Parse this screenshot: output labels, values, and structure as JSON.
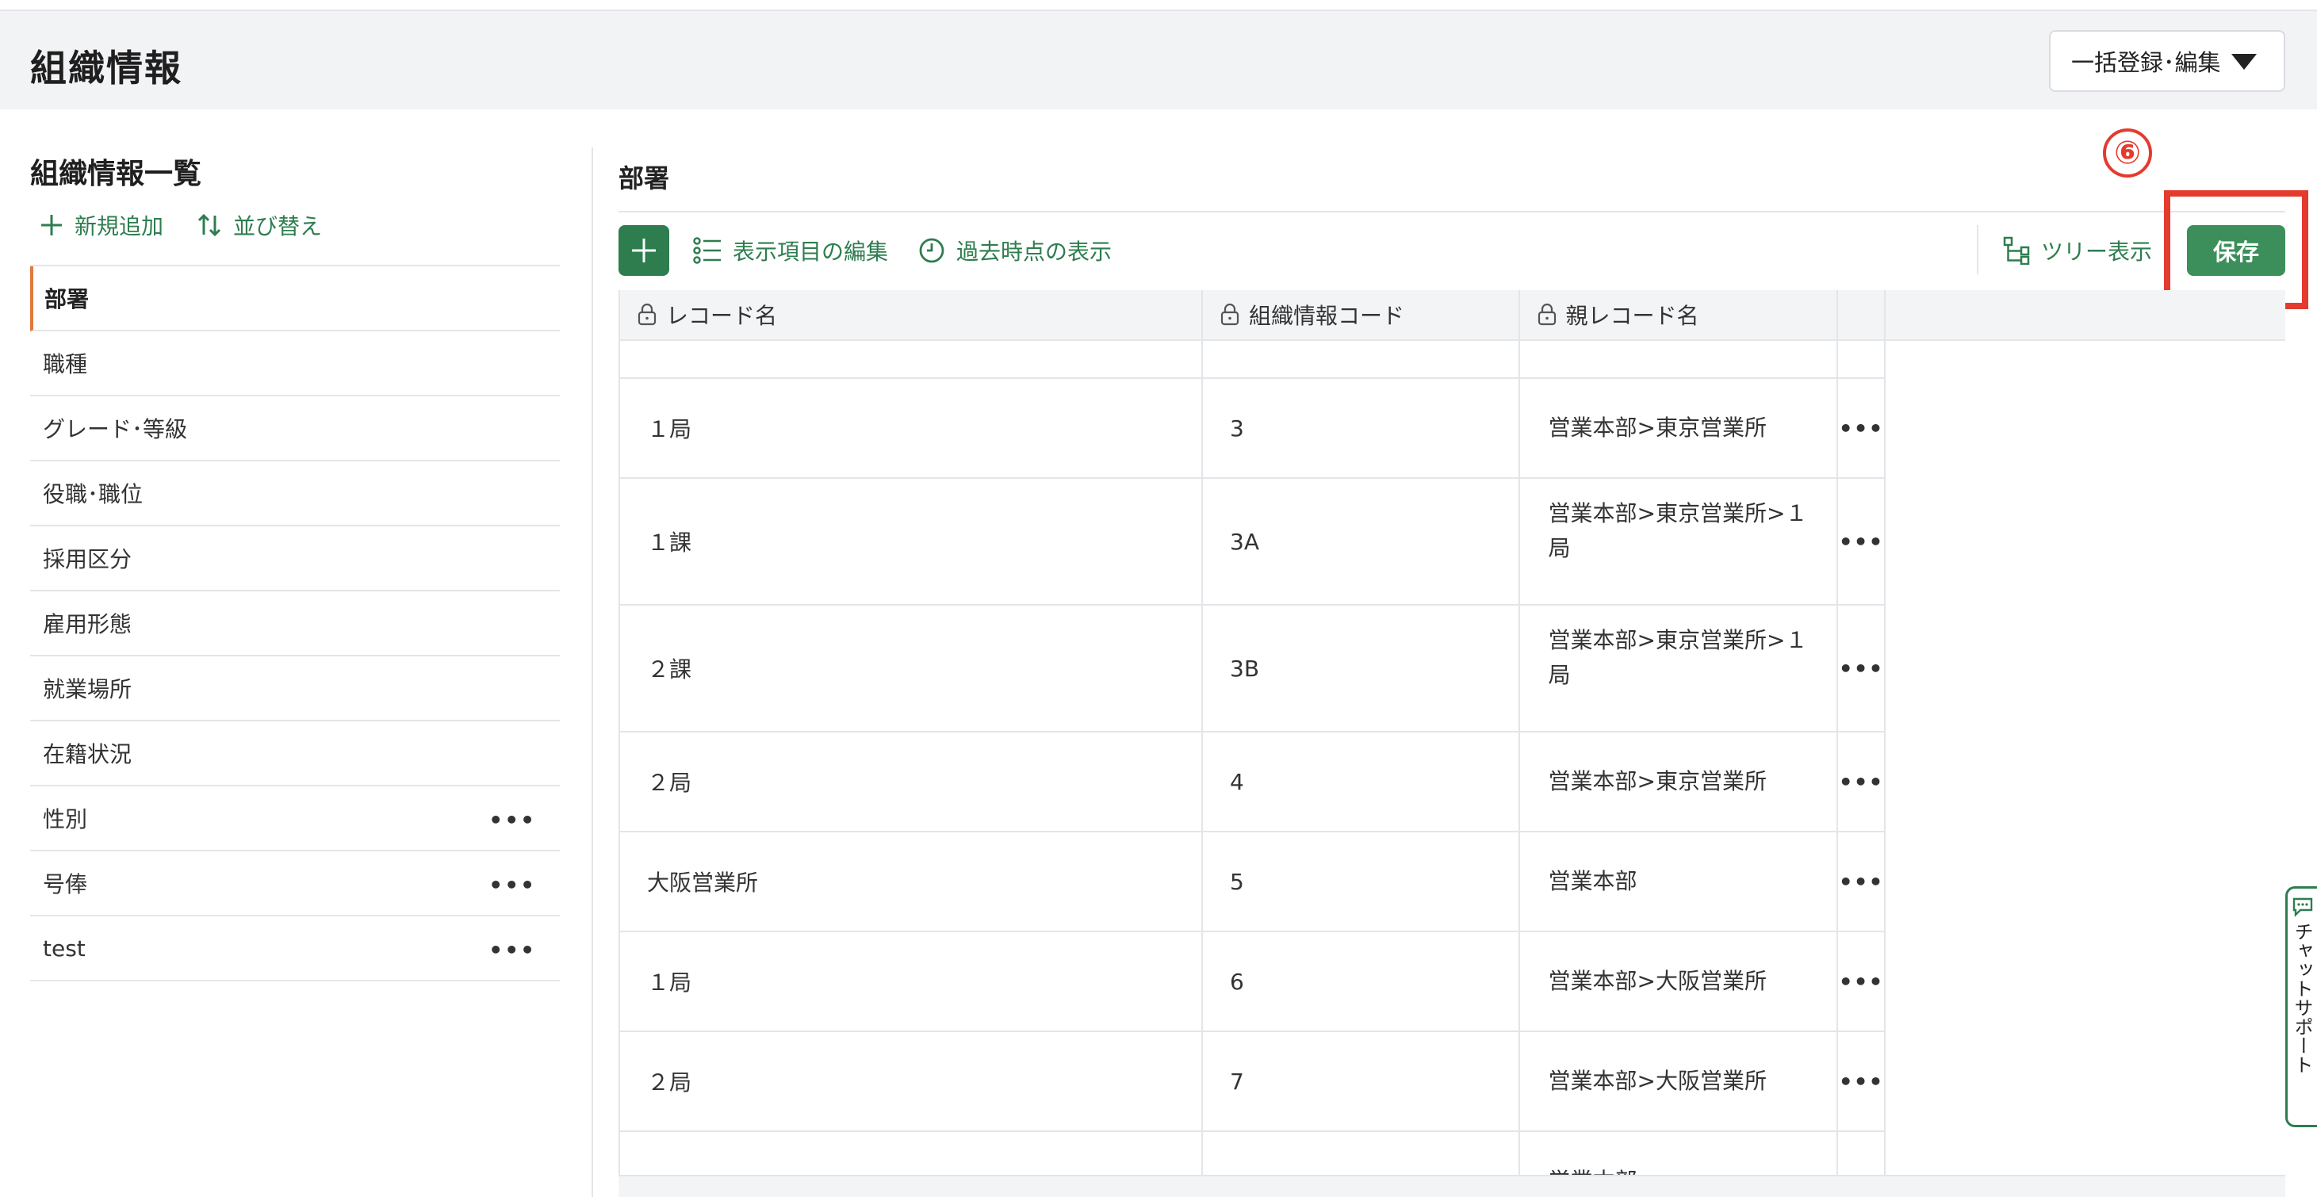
{
  "header": {
    "title": "組織情報",
    "bulk_button": "一括登録･編集"
  },
  "left": {
    "title": "組織情報一覧",
    "add_label": "新規追加",
    "sort_label": "並び替え",
    "items": [
      {
        "label": "部署",
        "active": true,
        "menu": false
      },
      {
        "label": "職種",
        "active": false,
        "menu": false
      },
      {
        "label": "グレード･等級",
        "active": false,
        "menu": false
      },
      {
        "label": "役職･職位",
        "active": false,
        "menu": false
      },
      {
        "label": "採用区分",
        "active": false,
        "menu": false
      },
      {
        "label": "雇用形態",
        "active": false,
        "menu": false
      },
      {
        "label": "就業場所",
        "active": false,
        "menu": false
      },
      {
        "label": "在籍状況",
        "active": false,
        "menu": false
      },
      {
        "label": "性別",
        "active": false,
        "menu": true
      },
      {
        "label": "号俸",
        "active": false,
        "menu": true
      },
      {
        "label": "test",
        "active": false,
        "menu": true
      }
    ]
  },
  "main": {
    "section_title": "部署",
    "toolbar": {
      "edit_columns": "表示項目の編集",
      "past_view": "過去時点の表示",
      "tree_view": "ツリー表示",
      "save": "保存"
    },
    "step_marker": "⑥",
    "columns": [
      "レコード名",
      "組織情報コード",
      "親レコード名"
    ],
    "row_menu": "•••",
    "rows": [
      {
        "name": "",
        "code": "",
        "parent": "",
        "partial": true
      },
      {
        "name": "１局",
        "code": "3",
        "parent": "営業本部>東京営業所"
      },
      {
        "name": "１課",
        "code": "3A",
        "parent": "営業本部>東京営業所>１局"
      },
      {
        "name": "２課",
        "code": "3B",
        "parent": "営業本部>東京営業所>１局"
      },
      {
        "name": "２局",
        "code": "4",
        "parent": "営業本部>東京営業所"
      },
      {
        "name": "大阪営業所",
        "code": "5",
        "parent": "営業本部"
      },
      {
        "name": "１局",
        "code": "6",
        "parent": "営業本部>大阪営業所"
      },
      {
        "name": "２局",
        "code": "7",
        "parent": "営業本部>大阪営業所"
      },
      {
        "name": ".",
        "code": "",
        "parent": "営業本部"
      }
    ]
  },
  "chat": {
    "label": "チャットサポート"
  },
  "colors": {
    "accent_green": "#2e7d4f",
    "save_green": "#3c8f5b",
    "highlight_red": "#e33b2e",
    "active_orange": "#e07a3a"
  }
}
